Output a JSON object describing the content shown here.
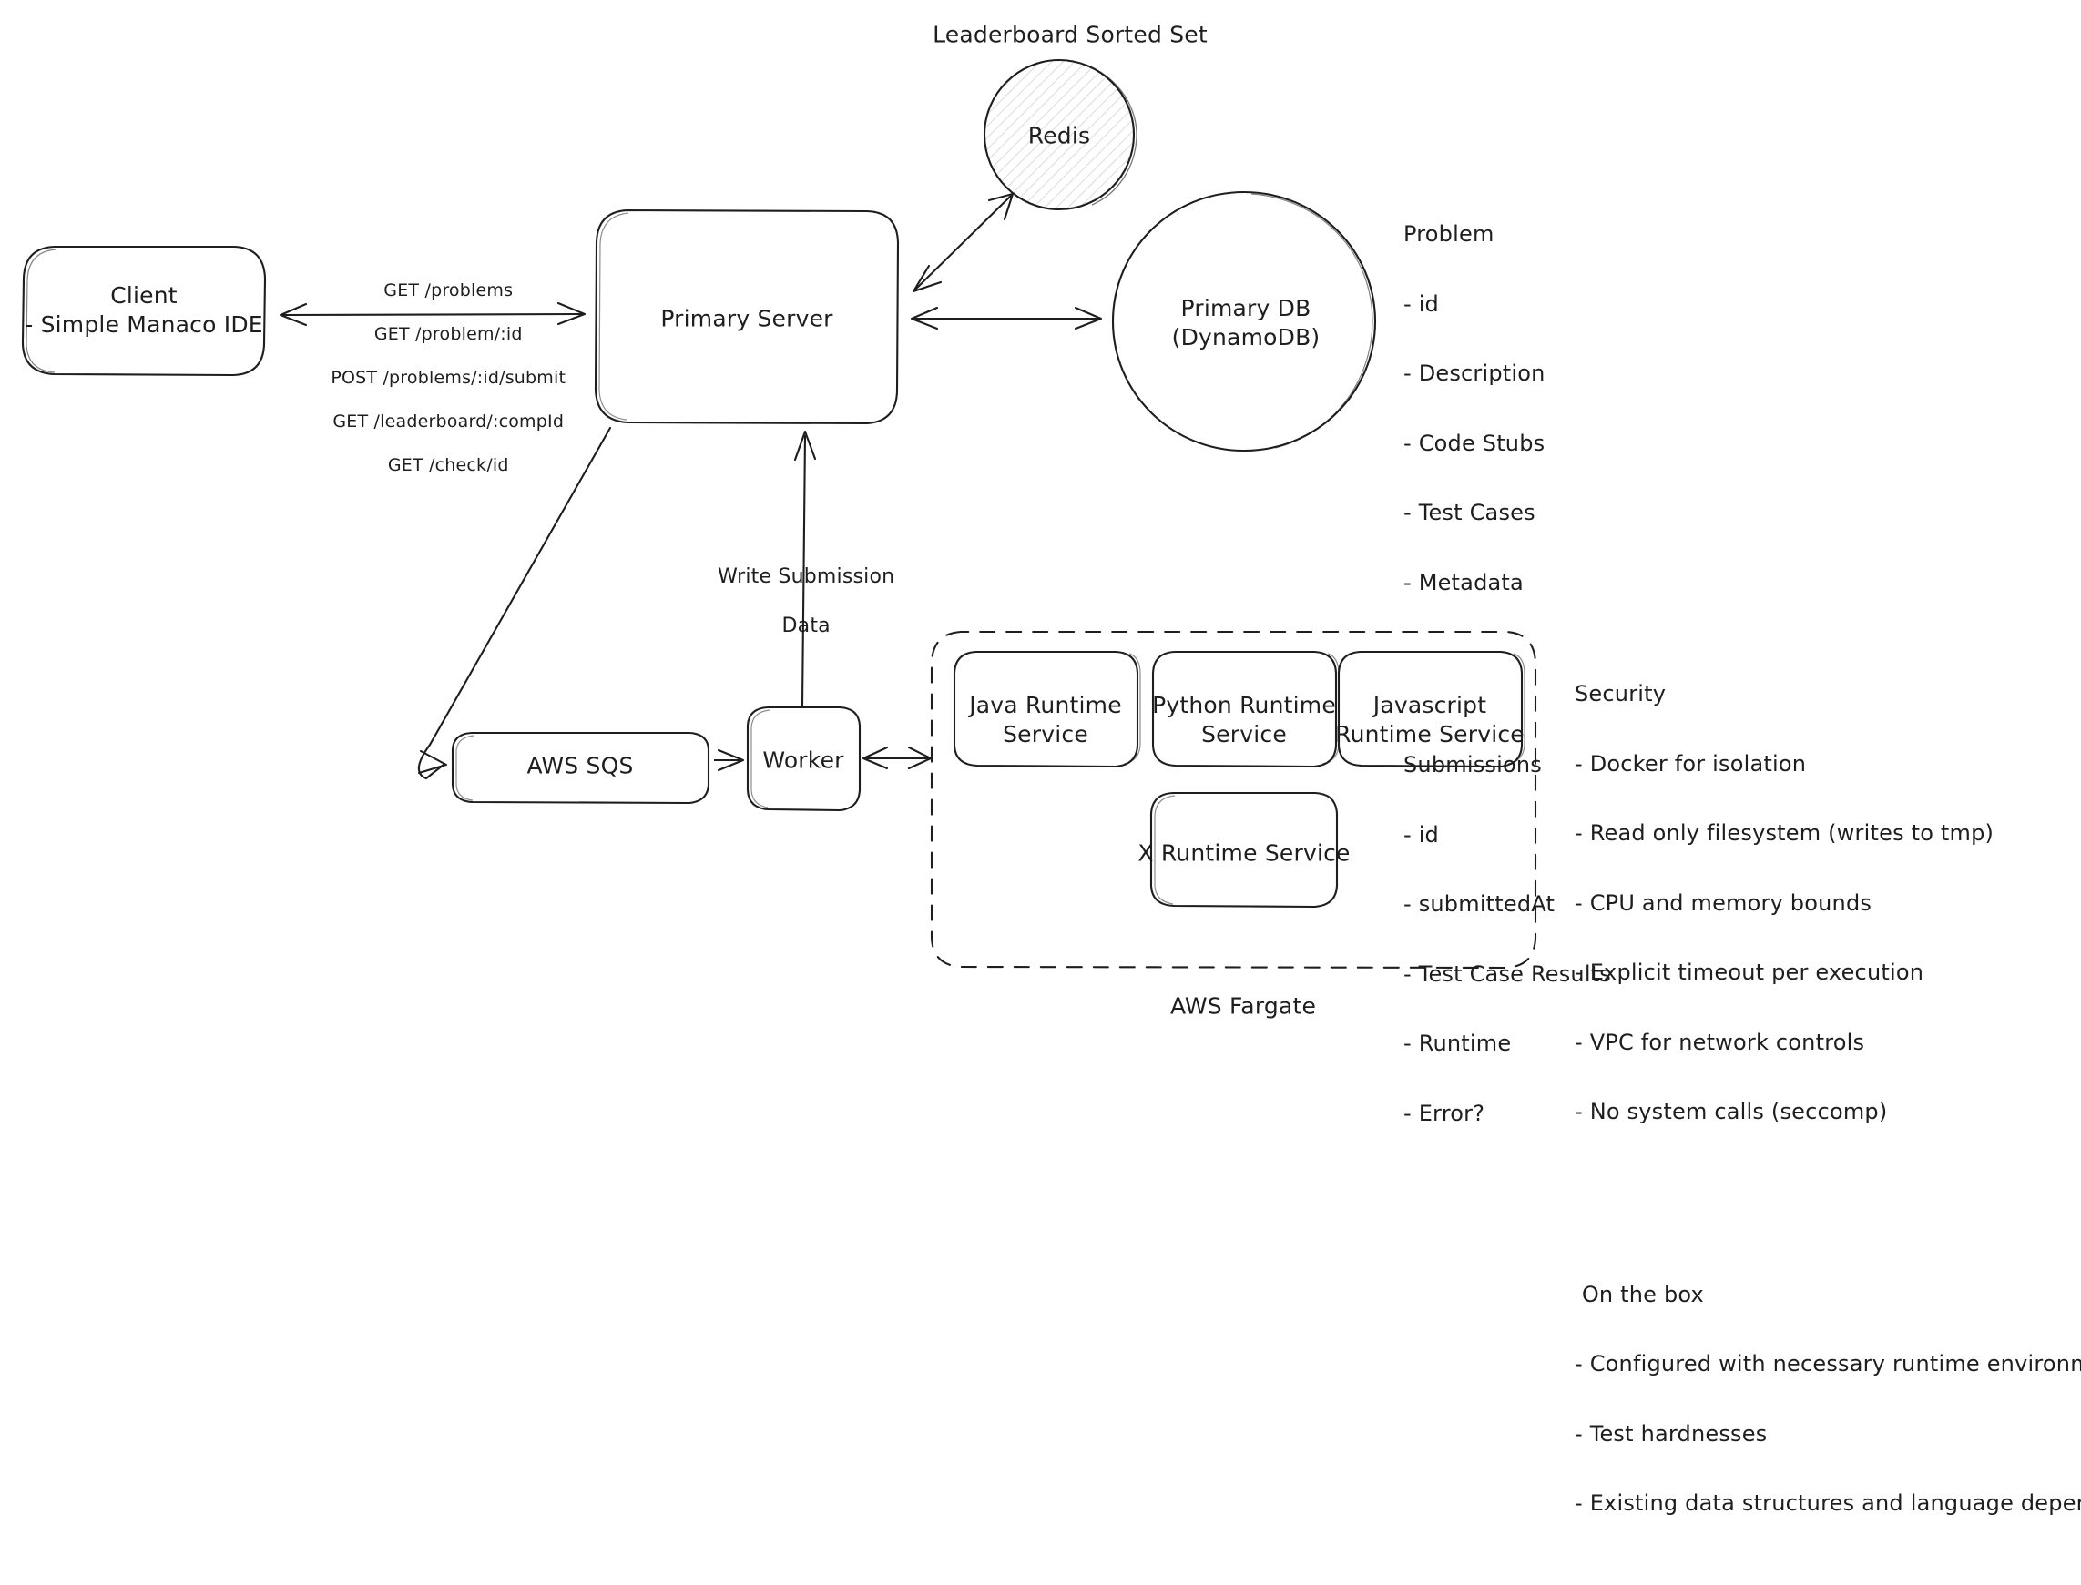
{
  "diagram": {
    "title_note": "Leaderboard Sorted Set",
    "fargate_caption": "AWS Fargate"
  },
  "nodes": {
    "client": {
      "line1": "Client",
      "line2": "- Simple Manaco IDE"
    },
    "primary_server": {
      "label": "Primary Server"
    },
    "redis": {
      "label": "Redis"
    },
    "primary_db": {
      "line1": "Primary DB",
      "line2": "(DynamoDB)"
    },
    "sqs": {
      "label": "AWS SQS"
    },
    "worker": {
      "label": "Worker"
    },
    "java_runtime": {
      "line1": "Java Runtime",
      "line2": "Service"
    },
    "python_runtime": {
      "line1": "Python Runtime",
      "line2": "Service"
    },
    "javascript_runtime": {
      "line1": "Javascript",
      "line2": "Runtime Service"
    },
    "x_runtime": {
      "label": "X Runtime Service"
    }
  },
  "edges": {
    "client_server_api": [
      "GET /problems",
      "GET /problem/:id",
      "POST /problems/:id/submit",
      "GET /leaderboard/:compId",
      "GET /check/id"
    ],
    "worker_server": {
      "line1": "Write Submission",
      "line2": "Data"
    }
  },
  "annotations": {
    "schema": {
      "groups": [
        {
          "header": "Problem",
          "items": [
            "- id",
            "- Description",
            "- Code Stubs",
            "- Test Cases",
            "- Metadata"
          ]
        },
        {
          "header": "Submissions",
          "items": [
            "- id",
            "- submittedAt",
            "- Test Case Results",
            "- Runtime",
            "- Error?"
          ]
        }
      ]
    },
    "security": {
      "groups": [
        {
          "header": "Security",
          "items": [
            "- Docker for isolation",
            "- Read only filesystem (writes to tmp)",
            "- CPU and memory bounds",
            "- Explicit timeout per execution",
            "- VPC for network controls",
            "- No system calls (seccomp)"
          ]
        },
        {
          "header": " On the box",
          "items": [
            "- Configured with necessary runtime environments",
            "- Test hardnesses",
            "- Existing data structures and language dependencies"
          ]
        }
      ]
    }
  },
  "colors": {
    "stroke": "#1e1e1e",
    "background": "#ffffff",
    "hatch": "#cfcfcf"
  }
}
